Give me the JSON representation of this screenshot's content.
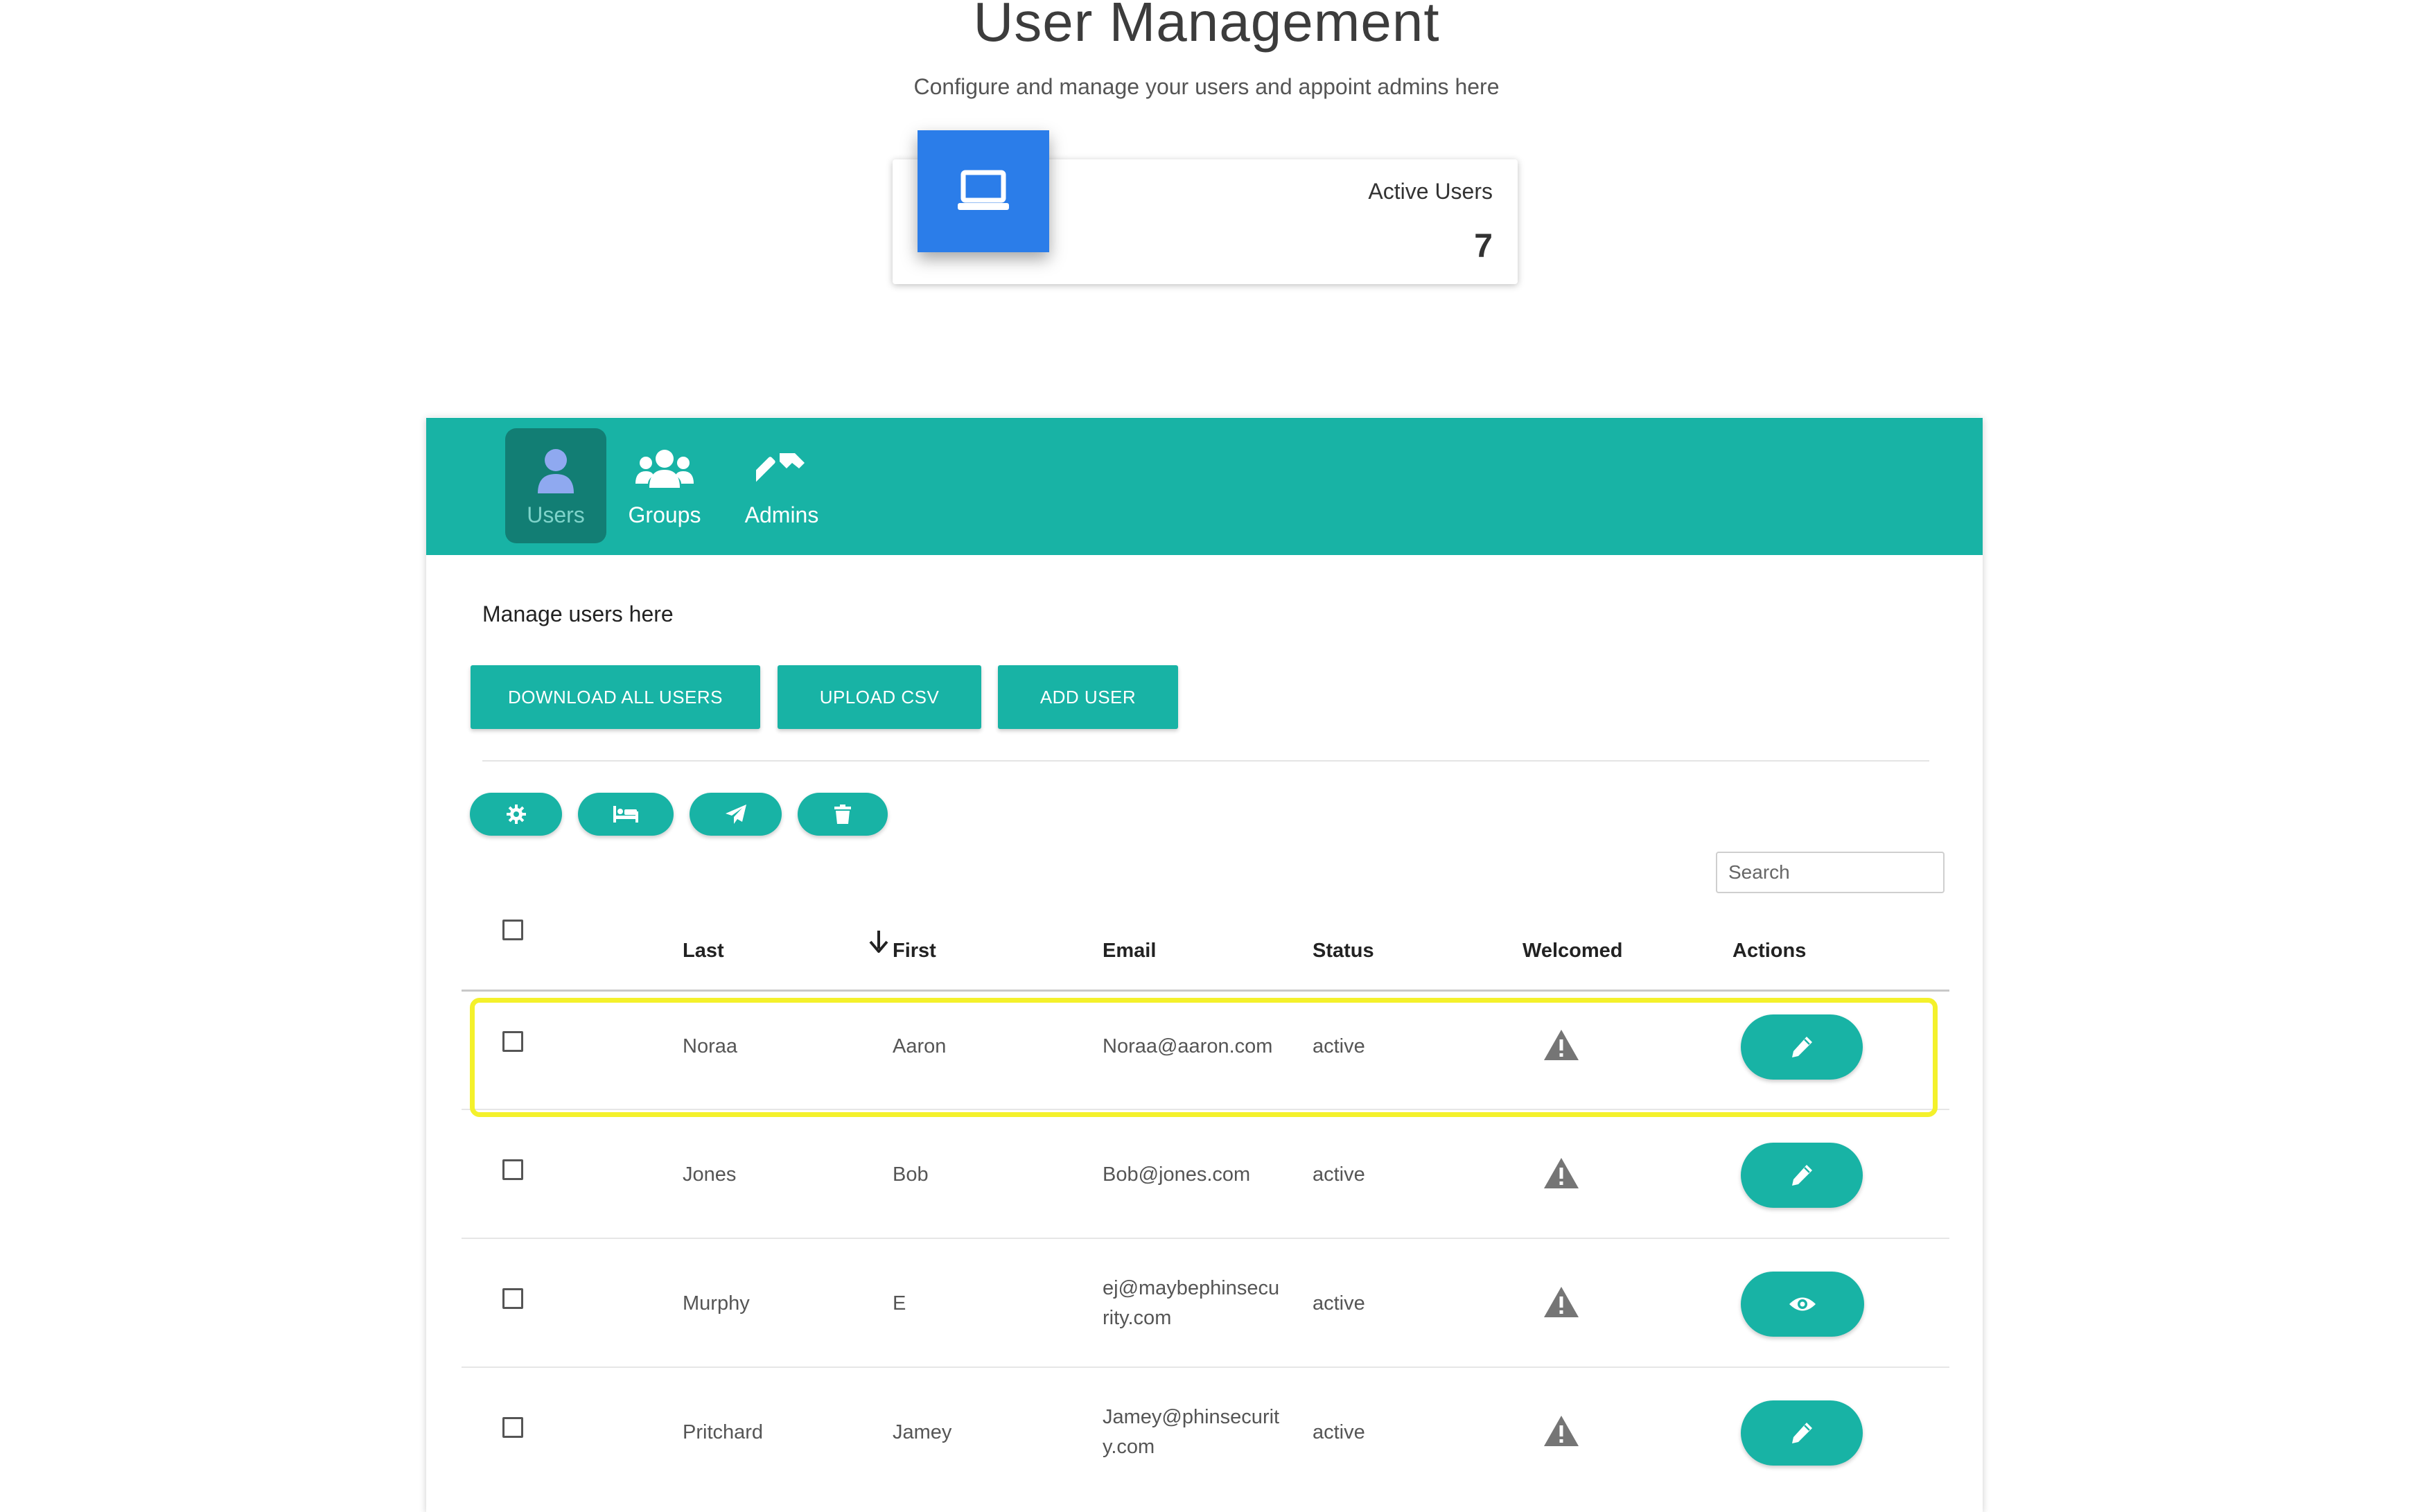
{
  "header": {
    "title": "User Management",
    "subtitle": "Configure and manage your users and appoint admins here"
  },
  "stat_card": {
    "icon": "laptop-icon",
    "label": "Active Users",
    "value": "7"
  },
  "tabs": [
    {
      "label": "Users",
      "icon": "user-icon",
      "active": true
    },
    {
      "label": "Groups",
      "icon": "users-group-icon",
      "active": false
    },
    {
      "label": "Admins",
      "icon": "hammer-icon",
      "active": false
    }
  ],
  "manage_text": "Manage users here",
  "buttons": {
    "download": "DOWNLOAD ALL USERS",
    "upload": "UPLOAD CSV",
    "add": "ADD USER"
  },
  "bulk_actions": [
    "gear-icon",
    "bed-icon",
    "send-icon",
    "trash-icon"
  ],
  "search": {
    "placeholder": "Search",
    "value": ""
  },
  "table": {
    "headers": {
      "last": "Last",
      "first": "First",
      "email": "Email",
      "status": "Status",
      "welcomed": "Welcomed",
      "actions": "Actions"
    },
    "sort": {
      "column": "first",
      "direction": "descending-arrow"
    },
    "rows": [
      {
        "last": "Noraa",
        "first": "Aaron",
        "email": [
          "Noraa@aaron.com"
        ],
        "status": "active",
        "welcomed_icon": "warning-icon",
        "action_icon": "pencil-icon",
        "highlighted": true
      },
      {
        "last": "Jones",
        "first": "Bob",
        "email": [
          "Bob@jones.com"
        ],
        "status": "active",
        "welcomed_icon": "warning-icon",
        "action_icon": "pencil-icon",
        "highlighted": false
      },
      {
        "last": "Murphy",
        "first": "E",
        "email": [
          "ej@maybephinsecu",
          "rity.com"
        ],
        "status": "active",
        "welcomed_icon": "warning-icon",
        "action_icon": "eye-icon",
        "highlighted": false
      },
      {
        "last": "Pritchard",
        "first": "Jamey",
        "email": [
          "Jamey@phinsecurit",
          "y.com"
        ],
        "status": "active",
        "welcomed_icon": "warning-icon",
        "action_icon": "pencil-icon",
        "highlighted": false
      }
    ]
  },
  "colors": {
    "accent": "#18b3a5",
    "accent_dark": "#127e74",
    "stat_icon_bg": "#2b7de9",
    "highlight": "#f4f12b",
    "warning": "#757575"
  }
}
